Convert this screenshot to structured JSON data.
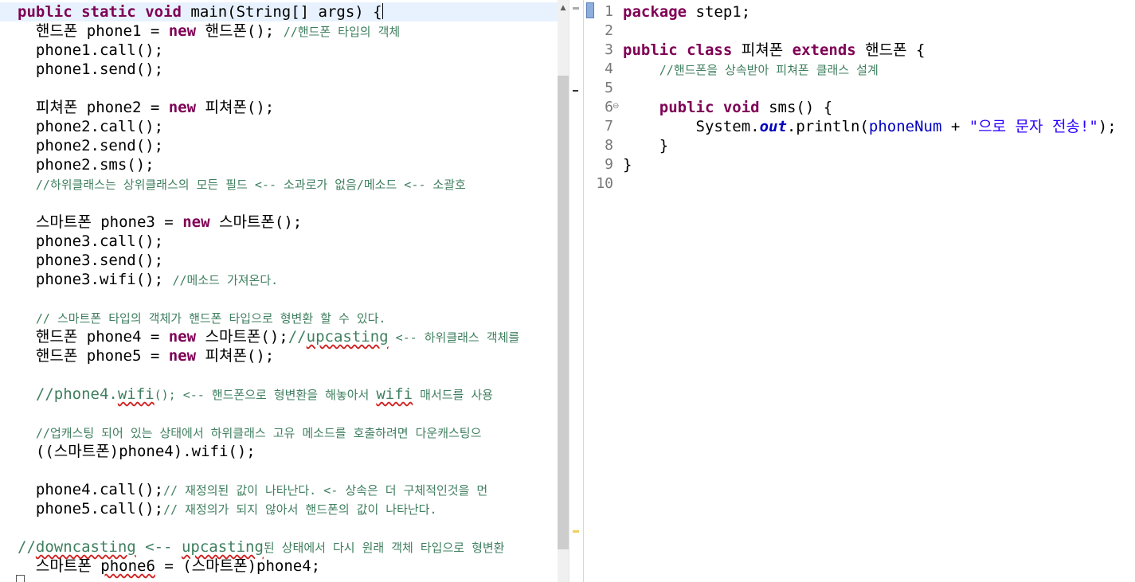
{
  "left_editor": {
    "lines": [
      {
        "segments": [
          {
            "t": "public",
            "c": "kw"
          },
          {
            "t": " ",
            "c": ""
          },
          {
            "t": "static",
            "c": "kw"
          },
          {
            "t": " ",
            "c": ""
          },
          {
            "t": "void",
            "c": "kw"
          },
          {
            "t": " main(String[] args) {",
            "c": ""
          }
        ]
      },
      {
        "segments": [
          {
            "t": "  핸드폰 phone1 = ",
            "c": ""
          },
          {
            "t": "new",
            "c": "kw"
          },
          {
            "t": " 핸드폰(); ",
            "c": ""
          },
          {
            "t": "//핸드폰 타입의 객체",
            "c": "cm"
          }
        ]
      },
      {
        "segments": [
          {
            "t": "  phone1.call();",
            "c": ""
          }
        ]
      },
      {
        "segments": [
          {
            "t": "  phone1.send();",
            "c": ""
          }
        ]
      },
      {
        "segments": [
          {
            "t": "",
            "c": ""
          }
        ]
      },
      {
        "segments": [
          {
            "t": "  피쳐폰 phone2 = ",
            "c": ""
          },
          {
            "t": "new",
            "c": "kw"
          },
          {
            "t": " 피쳐폰();",
            "c": ""
          }
        ]
      },
      {
        "segments": [
          {
            "t": "  phone2.call();",
            "c": ""
          }
        ]
      },
      {
        "segments": [
          {
            "t": "  phone2.send();",
            "c": ""
          }
        ]
      },
      {
        "segments": [
          {
            "t": "  phone2.sms();",
            "c": ""
          }
        ]
      },
      {
        "segments": [
          {
            "t": "  ",
            "c": ""
          },
          {
            "t": "//하위클래스는 상위클래스의 모든 필드 <-- 소과로가 없음/메소드 <-- 소괄호",
            "c": "cm"
          }
        ]
      },
      {
        "segments": [
          {
            "t": "",
            "c": ""
          }
        ]
      },
      {
        "segments": [
          {
            "t": "  스마트폰 phone3 = ",
            "c": ""
          },
          {
            "t": "new",
            "c": "kw"
          },
          {
            "t": " 스마트폰();",
            "c": ""
          }
        ]
      },
      {
        "segments": [
          {
            "t": "  phone3.call();",
            "c": ""
          }
        ]
      },
      {
        "segments": [
          {
            "t": "  phone3.send();",
            "c": ""
          }
        ]
      },
      {
        "segments": [
          {
            "t": "  phone3.wifi(); ",
            "c": ""
          },
          {
            "t": "//메소드 가져온다.",
            "c": "cm"
          }
        ]
      },
      {
        "segments": [
          {
            "t": "",
            "c": ""
          }
        ]
      },
      {
        "segments": [
          {
            "t": "  ",
            "c": ""
          },
          {
            "t": "// 스마트폰 타입의 객체가 핸드폰 타입으로 형변환 할 수 있다.",
            "c": "cm"
          }
        ]
      },
      {
        "segments": [
          {
            "t": "  핸드폰 phone4 = ",
            "c": ""
          },
          {
            "t": "new",
            "c": "kw"
          },
          {
            "t": " 스마트폰();",
            "c": ""
          },
          {
            "t": "//",
            "c": "cm"
          },
          {
            "t": "upcasting",
            "c": "cm wavy"
          },
          {
            "t": " <-- 하위클래스 객체를",
            "c": "cm"
          }
        ]
      },
      {
        "segments": [
          {
            "t": "  핸드폰 phone5 = ",
            "c": ""
          },
          {
            "t": "new",
            "c": "kw"
          },
          {
            "t": " 피쳐폰();",
            "c": ""
          }
        ]
      },
      {
        "segments": [
          {
            "t": "",
            "c": ""
          }
        ]
      },
      {
        "segments": [
          {
            "t": "  ",
            "c": ""
          },
          {
            "t": "//phone4.",
            "c": "cm"
          },
          {
            "t": "wifi",
            "c": "cm wavy"
          },
          {
            "t": "(); <-- 핸드폰으로 형변환을 해놓아서 ",
            "c": "cm"
          },
          {
            "t": "wifi",
            "c": "cm wavy"
          },
          {
            "t": " 매서드를 사용",
            "c": "cm"
          }
        ]
      },
      {
        "segments": [
          {
            "t": "",
            "c": ""
          }
        ]
      },
      {
        "segments": [
          {
            "t": "  ",
            "c": ""
          },
          {
            "t": "//업캐스팅 되어 있는 상태에서 하위클래스 고유 메소드를 호출하려면 다운캐스팅으",
            "c": "cm"
          }
        ]
      },
      {
        "segments": [
          {
            "t": "  ((스마트폰)phone4).wifi();",
            "c": ""
          }
        ]
      },
      {
        "segments": [
          {
            "t": "",
            "c": ""
          }
        ]
      },
      {
        "segments": [
          {
            "t": "  phone4.call();",
            "c": ""
          },
          {
            "t": "// 재정의된 값이 나타난다. <- 상속은 더 구체적인것을 먼",
            "c": "cm"
          }
        ]
      },
      {
        "segments": [
          {
            "t": "  phone5.call();",
            "c": ""
          },
          {
            "t": "// 재정의가 되지 않아서 핸드폰의 값이 나타난다.",
            "c": "cm"
          }
        ]
      },
      {
        "segments": [
          {
            "t": "",
            "c": ""
          }
        ]
      },
      {
        "segments": [
          {
            "t": "//",
            "c": "cm"
          },
          {
            "t": "downcasting",
            "c": "cm wavy"
          },
          {
            "t": " <-- ",
            "c": "cm"
          },
          {
            "t": "upcasting",
            "c": "cm wavy"
          },
          {
            "t": "된 상태에서 다시 원래 객체 타입으로 형변환",
            "c": "cm"
          }
        ]
      },
      {
        "segments": [
          {
            "t": "  스마트폰 ",
            "c": ""
          },
          {
            "t": "phone6",
            "c": "wavy"
          },
          {
            "t": " = (스마트폰)phone4;",
            "c": ""
          }
        ]
      }
    ]
  },
  "right_editor": {
    "line_numbers": [
      "1",
      "2",
      "3",
      "4",
      "5",
      "6",
      "7",
      "8",
      "9",
      "10"
    ],
    "lines": [
      {
        "segments": [
          {
            "t": "package",
            "c": "kw"
          },
          {
            "t": " step1;",
            "c": ""
          }
        ]
      },
      {
        "segments": [
          {
            "t": "",
            "c": ""
          }
        ]
      },
      {
        "segments": [
          {
            "t": "public",
            "c": "kw"
          },
          {
            "t": " ",
            "c": ""
          },
          {
            "t": "class",
            "c": "kw"
          },
          {
            "t": " 피쳐폰 ",
            "c": ""
          },
          {
            "t": "extends",
            "c": "kw"
          },
          {
            "t": " 핸드폰 {",
            "c": ""
          }
        ]
      },
      {
        "segments": [
          {
            "t": "    ",
            "c": ""
          },
          {
            "t": "//핸드폰을 상속받아 피쳐폰 클래스 설계",
            "c": "cm"
          }
        ]
      },
      {
        "segments": [
          {
            "t": "",
            "c": ""
          }
        ]
      },
      {
        "segments": [
          {
            "t": "    ",
            "c": ""
          },
          {
            "t": "public",
            "c": "kw"
          },
          {
            "t": " ",
            "c": ""
          },
          {
            "t": "void",
            "c": "kw"
          },
          {
            "t": " sms() {",
            "c": ""
          }
        ]
      },
      {
        "segments": [
          {
            "t": "        System.",
            "c": ""
          },
          {
            "t": "out",
            "c": "fld"
          },
          {
            "t": ".println(",
            "c": ""
          },
          {
            "t": "phoneNum",
            "c": "var"
          },
          {
            "t": " + ",
            "c": ""
          },
          {
            "t": "\"으로 문자 전송!\"",
            "c": "str"
          },
          {
            "t": ");",
            "c": ""
          }
        ]
      },
      {
        "segments": [
          {
            "t": "    }",
            "c": ""
          }
        ]
      },
      {
        "segments": [
          {
            "t": "}",
            "c": ""
          }
        ]
      },
      {
        "segments": [
          {
            "t": "",
            "c": ""
          }
        ]
      }
    ]
  },
  "icons": {
    "scroll_up": "scroll-up-arrow-icon",
    "fold_collapse": "fold-collapse-icon",
    "fold_minus": "fold-minus-icon"
  }
}
